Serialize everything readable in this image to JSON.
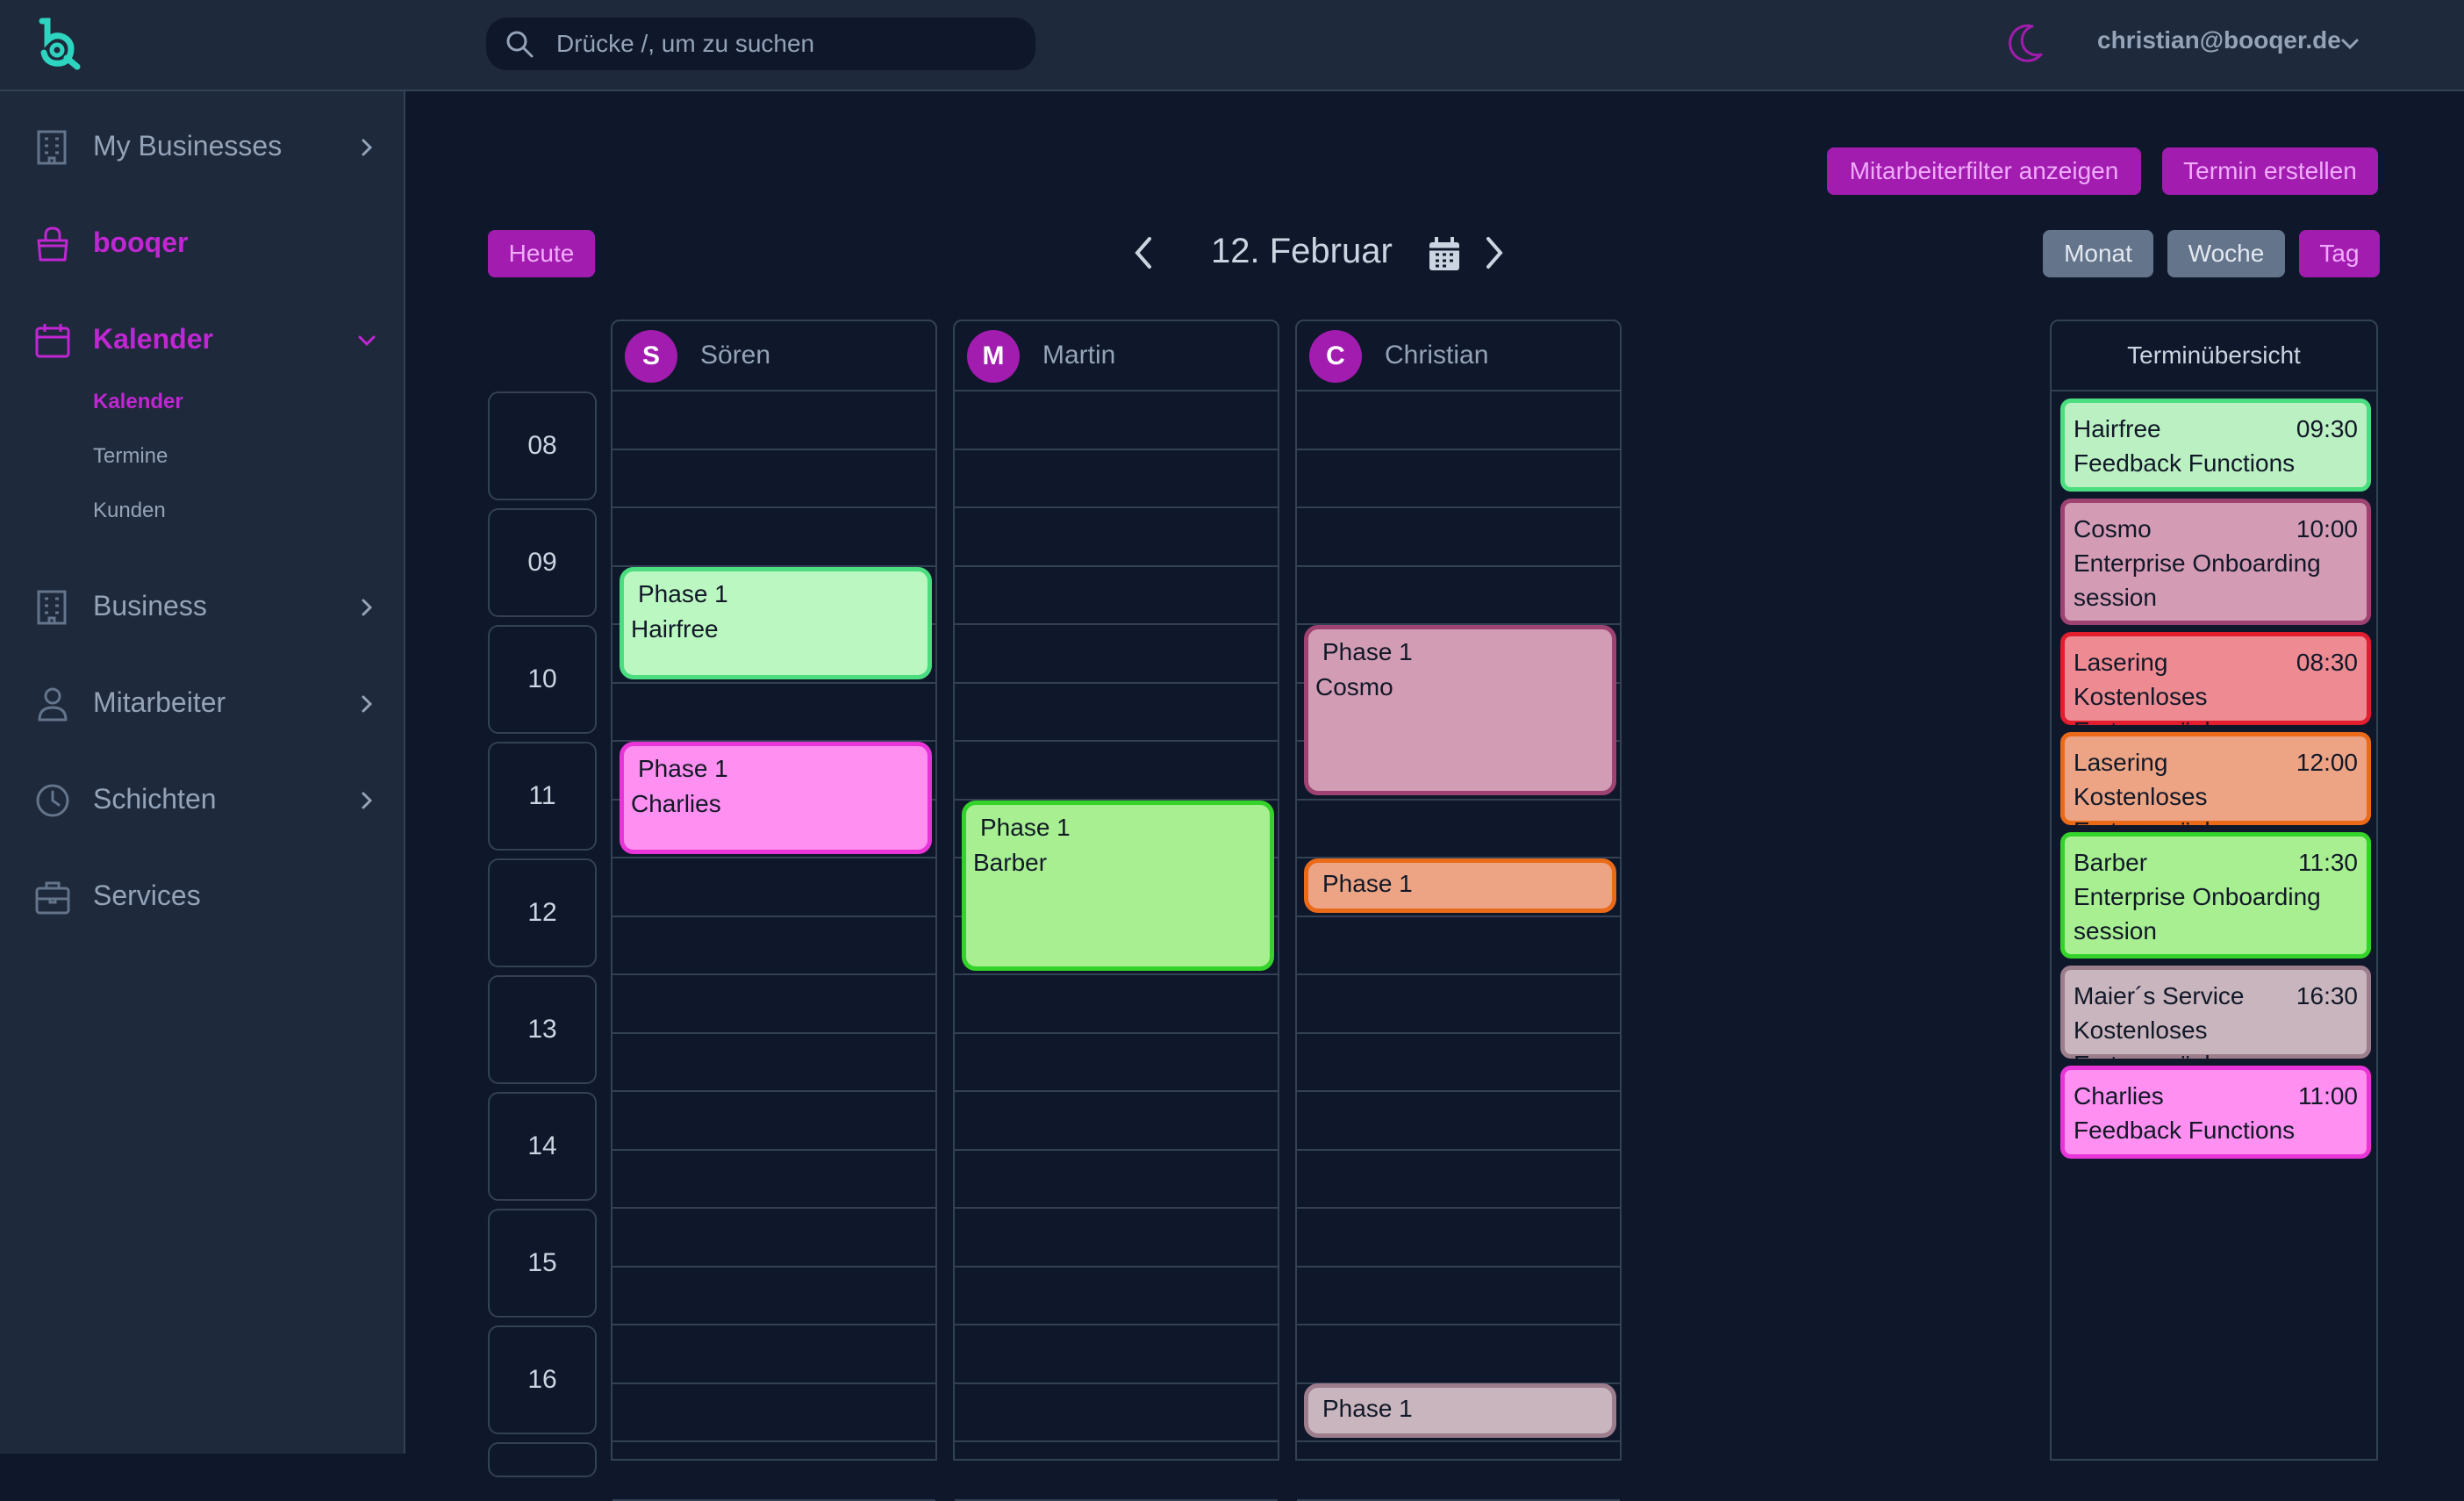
{
  "header": {
    "search_placeholder": "Drücke /, um zu suchen",
    "user_email": "christian@booqer.de"
  },
  "sidebar": {
    "items": [
      {
        "label": "My Businesses"
      },
      {
        "label": "booqer"
      },
      {
        "label": "Kalender"
      },
      {
        "label": "Business"
      },
      {
        "label": "Mitarbeiter"
      },
      {
        "label": "Schichten"
      },
      {
        "label": "Services"
      }
    ],
    "sub_items": [
      {
        "label": "Kalender"
      },
      {
        "label": "Termine"
      },
      {
        "label": "Kunden"
      }
    ]
  },
  "toolbar": {
    "filter_label": "Mitarbeiterfilter anzeigen",
    "create_label": "Termin erstellen",
    "today_label": "Heute",
    "date_label": "12. Februar",
    "view_month": "Monat",
    "view_week": "Woche",
    "view_day": "Tag"
  },
  "calendar": {
    "hours": [
      "08",
      "09",
      "10",
      "11",
      "12",
      "13",
      "14",
      "15",
      "16"
    ],
    "columns": [
      {
        "initial": "S",
        "name": "Sören"
      },
      {
        "initial": "M",
        "name": "Martin"
      },
      {
        "initial": "C",
        "name": "Christian"
      }
    ],
    "events": [
      {
        "phase": "Phase 1",
        "client": "Hairfree",
        "column": "Sören",
        "color": "#bbf7c0",
        "border": "#4ade80"
      },
      {
        "phase": "Phase 1",
        "client": "Charlies",
        "column": "Sören",
        "color": "#ff8ff0",
        "border": "#e935d8"
      },
      {
        "phase": "Phase 1",
        "client": "Barber",
        "column": "Martin",
        "color": "#a8ef92",
        "border": "#34d32a"
      },
      {
        "phase": "Phase 1",
        "client": "Cosmo",
        "column": "Christian",
        "color": "#d29cb4",
        "border": "#9d4271"
      },
      {
        "phase": "Phase 1",
        "client": "",
        "column": "Christian",
        "color": "#eda485",
        "border": "#ea6a18"
      },
      {
        "phase": "Phase 1",
        "client": "",
        "column": "Christian",
        "color": "#c9b5be",
        "border": "#9c7d8c"
      }
    ]
  },
  "overview": {
    "title": "Terminübersicht",
    "cards": [
      {
        "name": "Hairfree",
        "time": "09:30",
        "desc": "Feedback Functions",
        "color": "#bbf0c2",
        "border": "#4ade80"
      },
      {
        "name": "Cosmo",
        "time": "10:00",
        "desc": "Enterprise Onboarding session",
        "color": "#d49bb5",
        "border": "#9d4271"
      },
      {
        "name": "Lasering",
        "time": "08:30",
        "desc": "Kostenloses Erstgespräch",
        "color": "#ee8b92",
        "border": "#e11d2e"
      },
      {
        "name": "Lasering",
        "time": "12:00",
        "desc": "Kostenloses Erstgespräch",
        "color": "#eda485",
        "border": "#ea6a18"
      },
      {
        "name": "Barber",
        "time": "11:30",
        "desc": "Enterprise Onboarding session",
        "color": "#a8ef92",
        "border": "#34d32a"
      },
      {
        "name": "Maier´s Service",
        "time": "16:30",
        "desc": "Kostenloses Erstgespräch",
        "color": "#c9b5be",
        "border": "#9c7d8c"
      },
      {
        "name": "Charlies",
        "time": "11:00",
        "desc": "Feedback Functions",
        "color": "#ff8ff0",
        "border": "#e935d8"
      }
    ]
  },
  "colors": {
    "accent": "#a21caf",
    "background": "#0f172a",
    "panel": "#1e293b"
  }
}
